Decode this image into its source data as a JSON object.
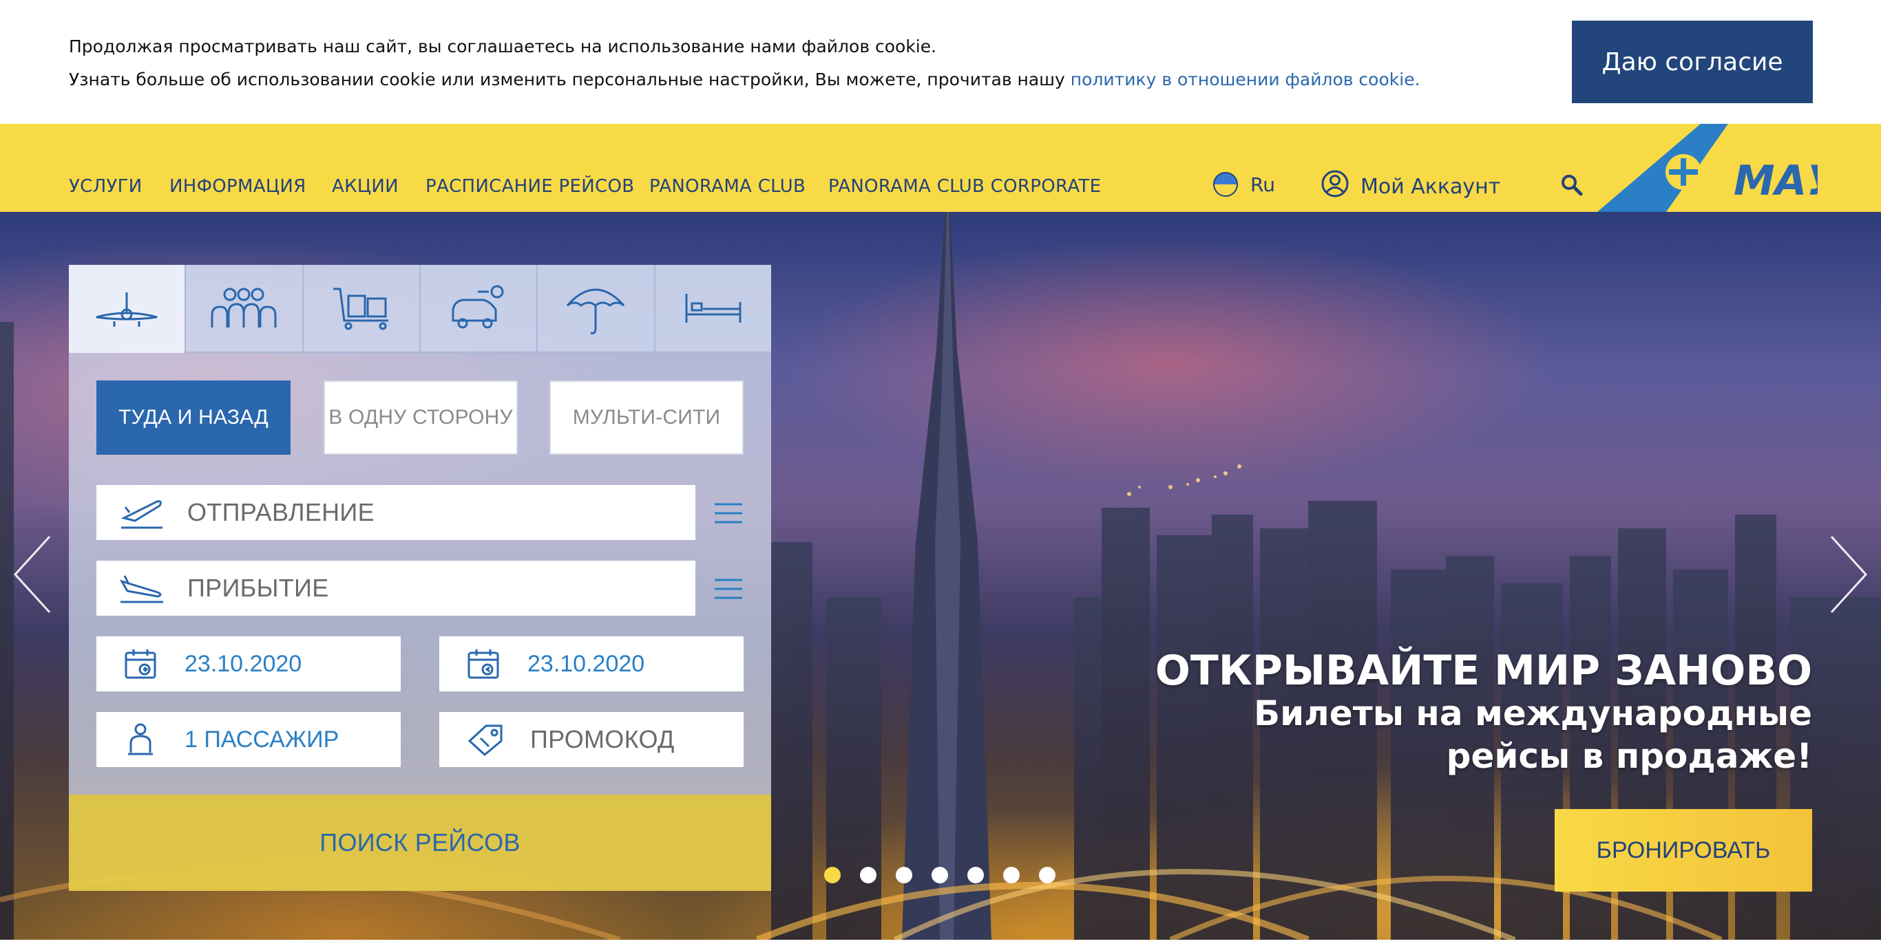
{
  "cookie": {
    "line1": "Продолжая просматривать наш сайт, вы соглашаетесь на использование нами файлов cookie.",
    "line2_prefix": "Узнать больше об использовании cookie или изменить персональные настройки, Вы можете, прочитав нашу ",
    "link": "политику в отношении файлов cookie.",
    "consent_button": "Даю согласие"
  },
  "nav": {
    "items": [
      "УСЛУГИ",
      "ИНФОРМАЦИЯ",
      "АКЦИИ",
      "РАСПИСАНИЕ РЕЙСОВ",
      "PANORAMA CLUB",
      "PANORAMA CLUB CORPORATE"
    ],
    "language": "Ru",
    "account": "Мой Аккаунт",
    "logo_text": "МАУ"
  },
  "booking": {
    "tabs": [
      "plane-icon",
      "group-icon",
      "luggage-icon",
      "car-icon",
      "umbrella-icon",
      "bed-icon"
    ],
    "trip_types": [
      "ТУДА И НАЗАД",
      "В ОДНУ СТОРОНУ",
      "МУЛЬТИ-СИТИ"
    ],
    "departure_placeholder": "ОТПРАВЛЕНИЕ",
    "arrival_placeholder": "ПРИБЫТИЕ",
    "date_out": "23.10.2020",
    "date_back": "23.10.2020",
    "passengers": "1 ПАССАЖИР",
    "promo": "ПРОМОКОД",
    "search_button": "ПОИСК РЕЙСОВ"
  },
  "promo": {
    "title": "ОТКРЫВАЙТЕ МИР ЗАНОВО",
    "subtitle": "Билеты на международные рейсы в продаже!",
    "button": "БРОНИРОВАТЬ"
  },
  "slider": {
    "count": 7,
    "active": 1
  },
  "colors": {
    "brand_blue": "#21437b",
    "accent_blue": "#2a67ad",
    "brand_yellow": "#f8d946"
  }
}
